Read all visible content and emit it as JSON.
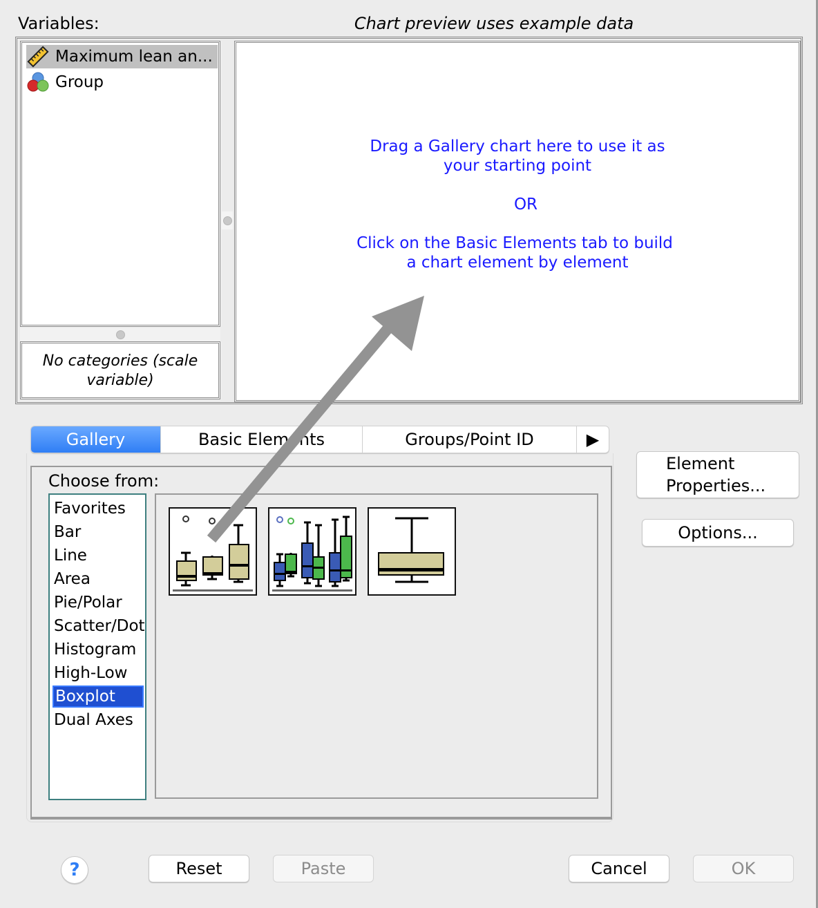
{
  "variables_label": "Variables:",
  "preview_label": "Chart preview uses example data",
  "variables": [
    {
      "name": "Maximum lean an...",
      "icon": "scale-ruler-icon",
      "selected": true
    },
    {
      "name": "Group",
      "icon": "nominal-circles-icon",
      "selected": false
    }
  ],
  "categories_text_1": "No categories (scale",
  "categories_text_2": "variable)",
  "preview_hints": {
    "line1": "Drag a Gallery chart here to use it as",
    "line2": "your starting point",
    "or": "OR",
    "line3": "Click on the Basic Elements tab to build",
    "line4": "a chart element by element"
  },
  "tabs": [
    {
      "label": "Gallery",
      "active": true
    },
    {
      "label": "Basic Elements",
      "active": false
    },
    {
      "label": "Groups/Point ID",
      "active": false
    }
  ],
  "tab_more_icon": "▶",
  "choose_from_label": "Choose from:",
  "chart_types": [
    "Favorites",
    "Bar",
    "Line",
    "Area",
    "Pie/Polar",
    "Scatter/Dot",
    "Histogram",
    "High-Low",
    "Boxplot",
    "Dual Axes"
  ],
  "selected_chart_type": "Boxplot",
  "gallery_thumbnails": [
    {
      "name": "simple-boxplot"
    },
    {
      "name": "clustered-boxplot"
    },
    {
      "name": "1-d-boxplot"
    }
  ],
  "buttons": {
    "element_properties_1": "Element",
    "element_properties_2": "Properties...",
    "options": "Options...",
    "help": "?",
    "reset": "Reset",
    "paste": "Paste",
    "cancel": "Cancel",
    "ok": "OK"
  },
  "colors": {
    "hint_text": "#1a1aff",
    "tab_active": "#2f7ef5",
    "list_selected": "#1f4fd1",
    "box_fill": "#d3cd9a",
    "blue_box": "#3a5bb5",
    "green_box": "#4cb84c"
  }
}
